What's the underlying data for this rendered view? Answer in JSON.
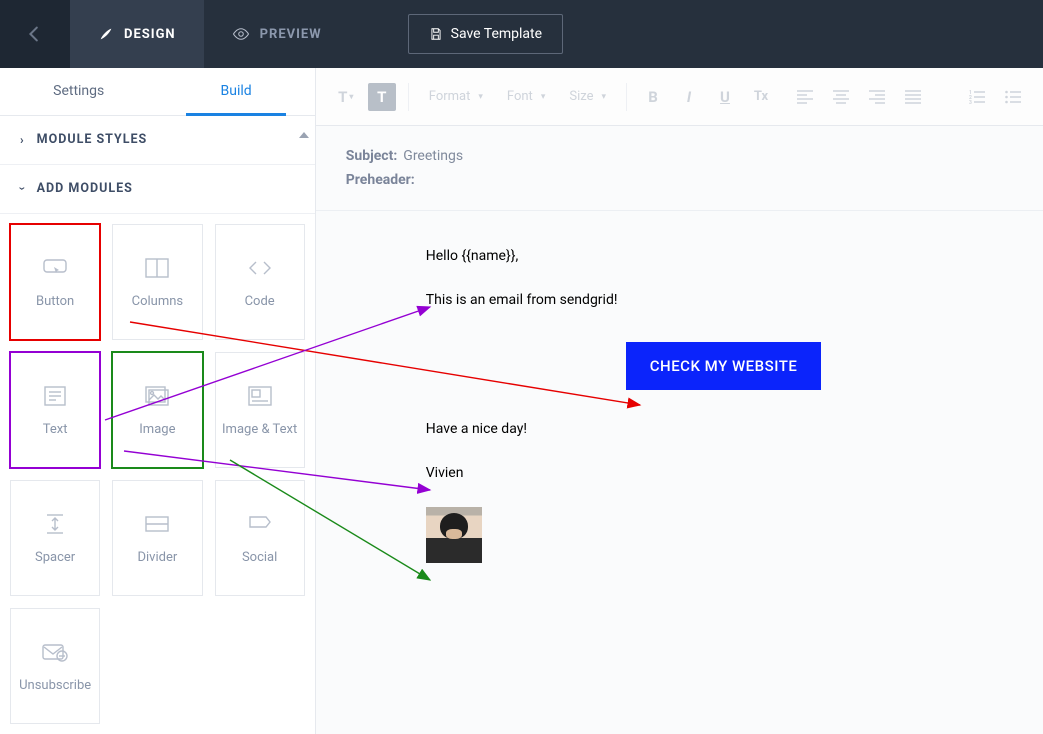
{
  "topbar": {
    "tab_design": "DESIGN",
    "tab_preview": "PREVIEW",
    "save_label": "Save Template"
  },
  "sidebar": {
    "tab_settings": "Settings",
    "tab_build": "Build",
    "module_styles": "MODULE STYLES",
    "add_modules": "ADD MODULES",
    "modules": {
      "button": "Button",
      "columns": "Columns",
      "code": "Code",
      "text": "Text",
      "image": "Image",
      "imagetext": "Image & Text",
      "spacer": "Spacer",
      "divider": "Divider",
      "social": "Social",
      "unsubscribe": "Unsubscribe"
    }
  },
  "toolbar": {
    "tmode": "T",
    "tbg": "T",
    "format": "Format",
    "font": "Font",
    "size": "Size",
    "bold": "B",
    "italic": "I",
    "underline": "U",
    "clear": "Tx"
  },
  "canvas": {
    "subject_label": "Subject:",
    "subject_value": "Greetings",
    "preheader_label": "Preheader:",
    "preheader_value": "",
    "p1": "Hello {{name}},",
    "p2": "This is an email from sendgrid!",
    "cta": "CHECK MY WEBSITE",
    "p3": "Have a nice day!",
    "sig": "Vivien"
  }
}
